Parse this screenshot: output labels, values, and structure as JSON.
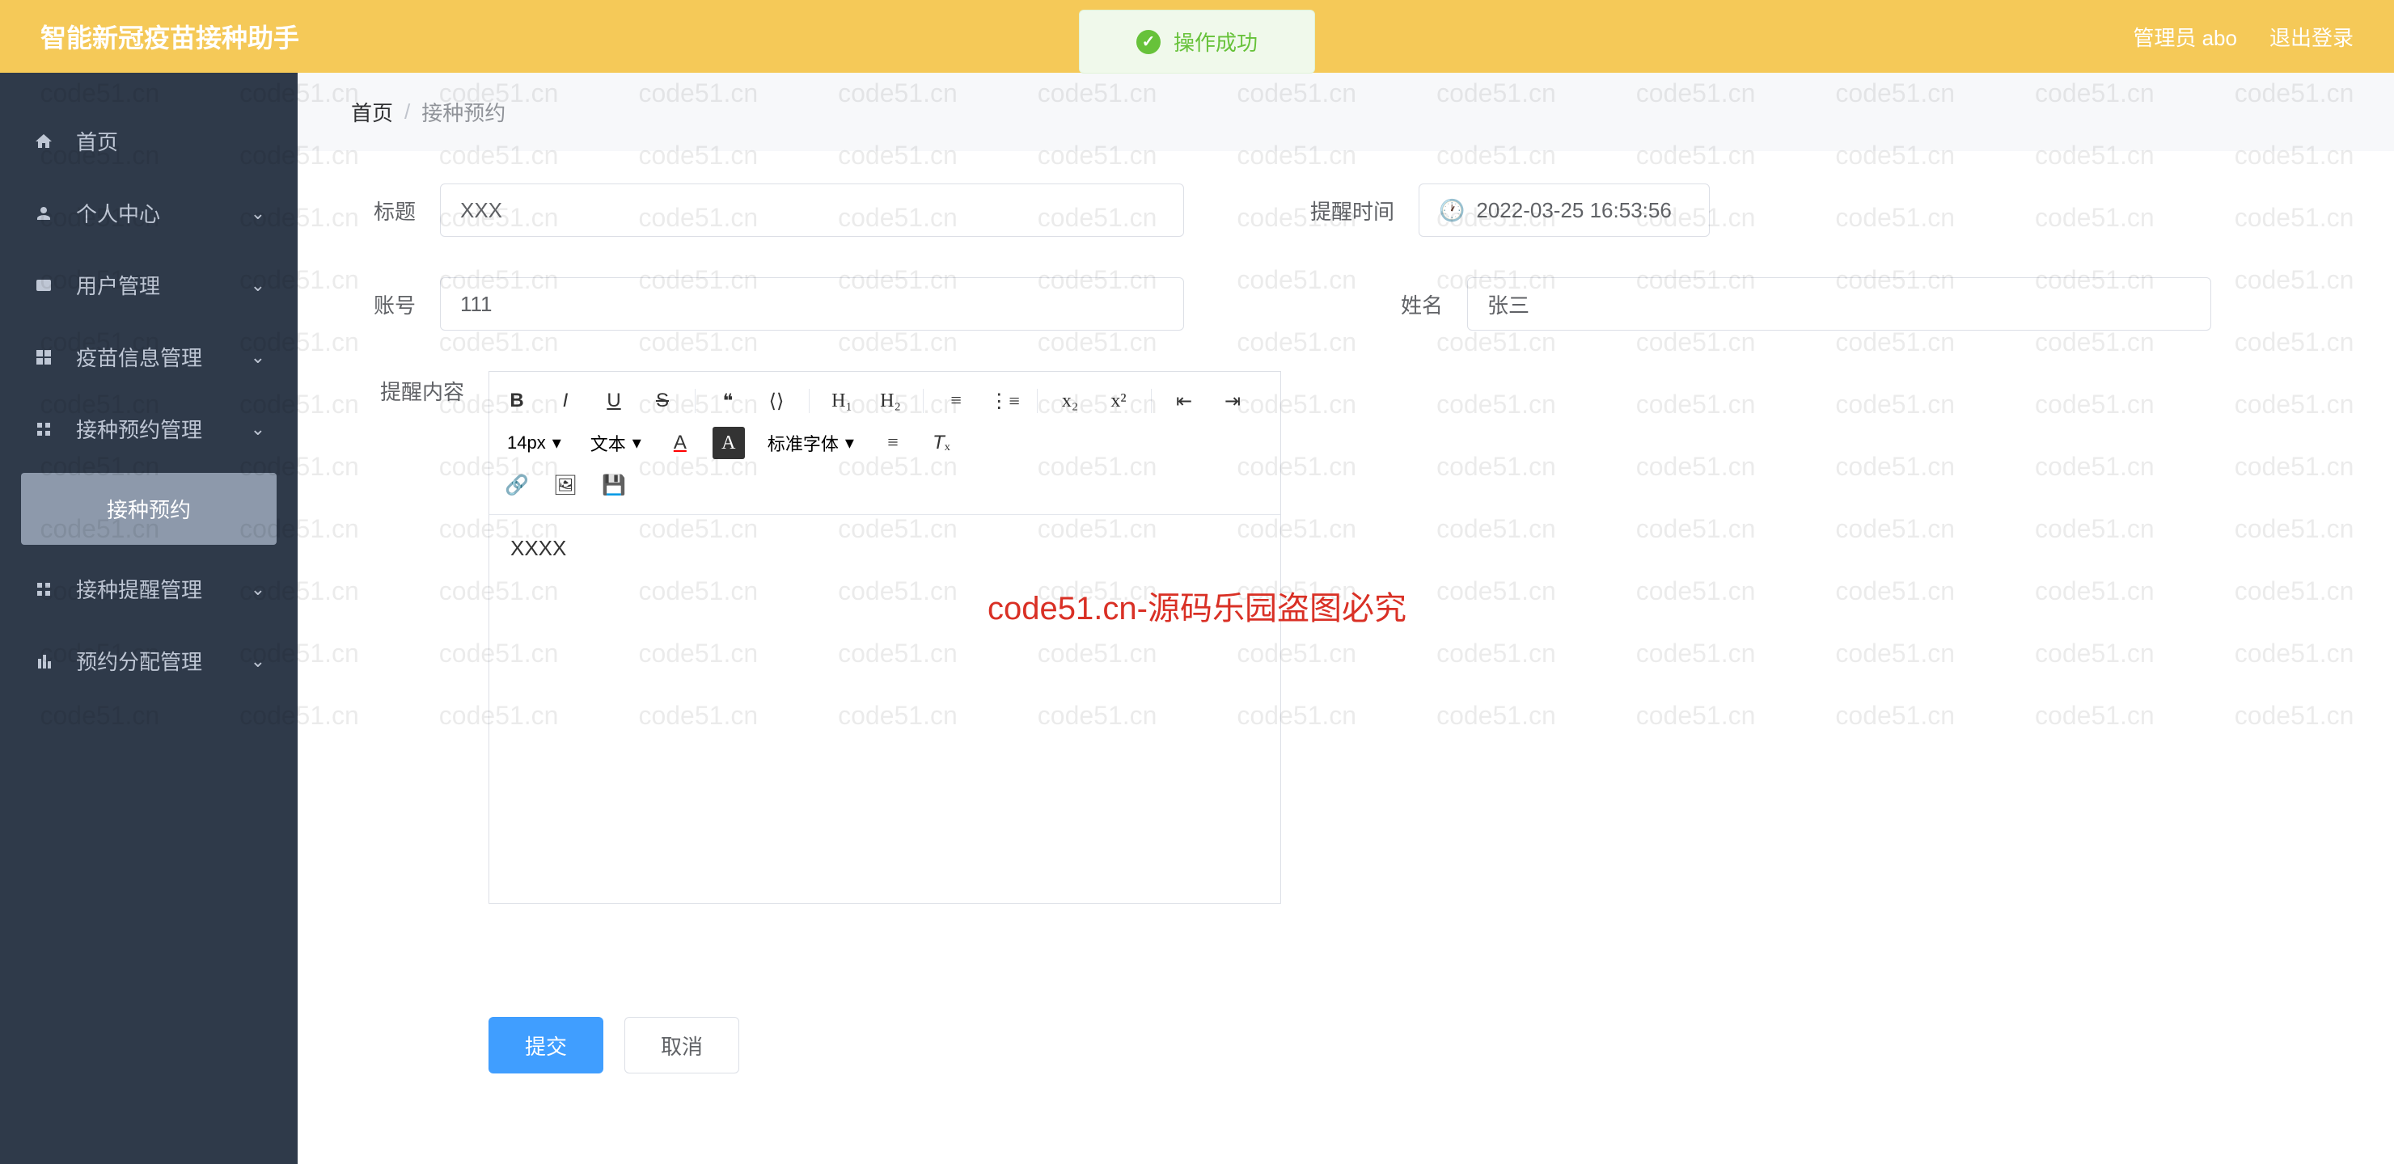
{
  "app": {
    "title": "智能新冠疫苗接种助手"
  },
  "header": {
    "admin": "管理员 abo",
    "logout": "退出登录"
  },
  "toast": {
    "text": "操作成功"
  },
  "sidebar": {
    "items": [
      {
        "label": "首页",
        "icon": "home",
        "expandable": false
      },
      {
        "label": "个人中心",
        "icon": "user",
        "expandable": true
      },
      {
        "label": "用户管理",
        "icon": "users",
        "expandable": true
      },
      {
        "label": "疫苗信息管理",
        "icon": "grid",
        "expandable": true
      },
      {
        "label": "接种预约管理",
        "icon": "grid2",
        "expandable": true,
        "sub": [
          {
            "label": "接种预约"
          }
        ]
      },
      {
        "label": "接种提醒管理",
        "icon": "grid3",
        "expandable": true
      },
      {
        "label": "预约分配管理",
        "icon": "chart",
        "expandable": true
      }
    ]
  },
  "breadcrumb": {
    "home": "首页",
    "current": "接种预约"
  },
  "form": {
    "title_label": "标题",
    "title_value": "XXX",
    "time_label": "提醒时间",
    "time_value": "2022-03-25 16:53:56",
    "account_label": "账号",
    "account_value": "111",
    "name_label": "姓名",
    "name_value": "张三",
    "content_label": "提醒内容",
    "content_value": "XXXX"
  },
  "editor_toolbar": {
    "font_size": "14px",
    "format": "文本",
    "font_family": "标准字体"
  },
  "buttons": {
    "submit": "提交",
    "cancel": "取消"
  },
  "watermark": {
    "text": "code51.cn",
    "center": "code51.cn-源码乐园盗图必究"
  }
}
